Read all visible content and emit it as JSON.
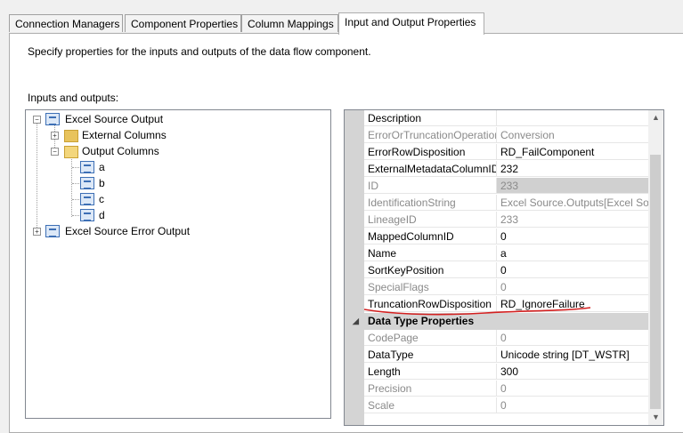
{
  "tabs": [
    {
      "label": "Connection Managers"
    },
    {
      "label": "Component Properties"
    },
    {
      "label": "Column Mappings"
    },
    {
      "label": "Input and Output Properties"
    }
  ],
  "description": "Specify properties for the inputs and outputs of the data flow component.",
  "inputs_outputs_label": "Inputs and outputs:",
  "tree": {
    "source_output": "Excel Source Output",
    "external_columns": "External Columns",
    "output_columns": "Output Columns",
    "columns": [
      "a",
      "b",
      "c",
      "d"
    ],
    "error_output": "Excel Source Error Output"
  },
  "properties": [
    {
      "name": "Description",
      "value": "",
      "readonly": false
    },
    {
      "name": "ErrorOrTruncationOperation",
      "value": "Conversion",
      "readonly": true
    },
    {
      "name": "ErrorRowDisposition",
      "value": "RD_FailComponent",
      "readonly": false
    },
    {
      "name": "ExternalMetadataColumnID",
      "value": "232",
      "readonly": false
    },
    {
      "name": "ID",
      "value": "233",
      "readonly": true
    },
    {
      "name": "IdentificationString",
      "value": "Excel Source.Outputs[Excel Sour",
      "readonly": true
    },
    {
      "name": "LineageID",
      "value": "233",
      "readonly": true
    },
    {
      "name": "MappedColumnID",
      "value": "0",
      "readonly": false
    },
    {
      "name": "Name",
      "value": "a",
      "readonly": false
    },
    {
      "name": "SortKeyPosition",
      "value": "0",
      "readonly": false
    },
    {
      "name": "SpecialFlags",
      "value": "0",
      "readonly": true
    },
    {
      "name": "TruncationRowDisposition",
      "value": "RD_IgnoreFailure",
      "readonly": false
    }
  ],
  "category": "Data Type Properties",
  "type_properties": [
    {
      "name": "CodePage",
      "value": "0",
      "readonly": true
    },
    {
      "name": "DataType",
      "value": "Unicode string [DT_WSTR]",
      "readonly": false
    },
    {
      "name": "Length",
      "value": "300",
      "readonly": false
    },
    {
      "name": "Precision",
      "value": "0",
      "readonly": true
    },
    {
      "name": "Scale",
      "value": "0",
      "readonly": true
    }
  ],
  "colors": {
    "annotation": "#d32020",
    "readonly_text": "#8a8a8a"
  }
}
